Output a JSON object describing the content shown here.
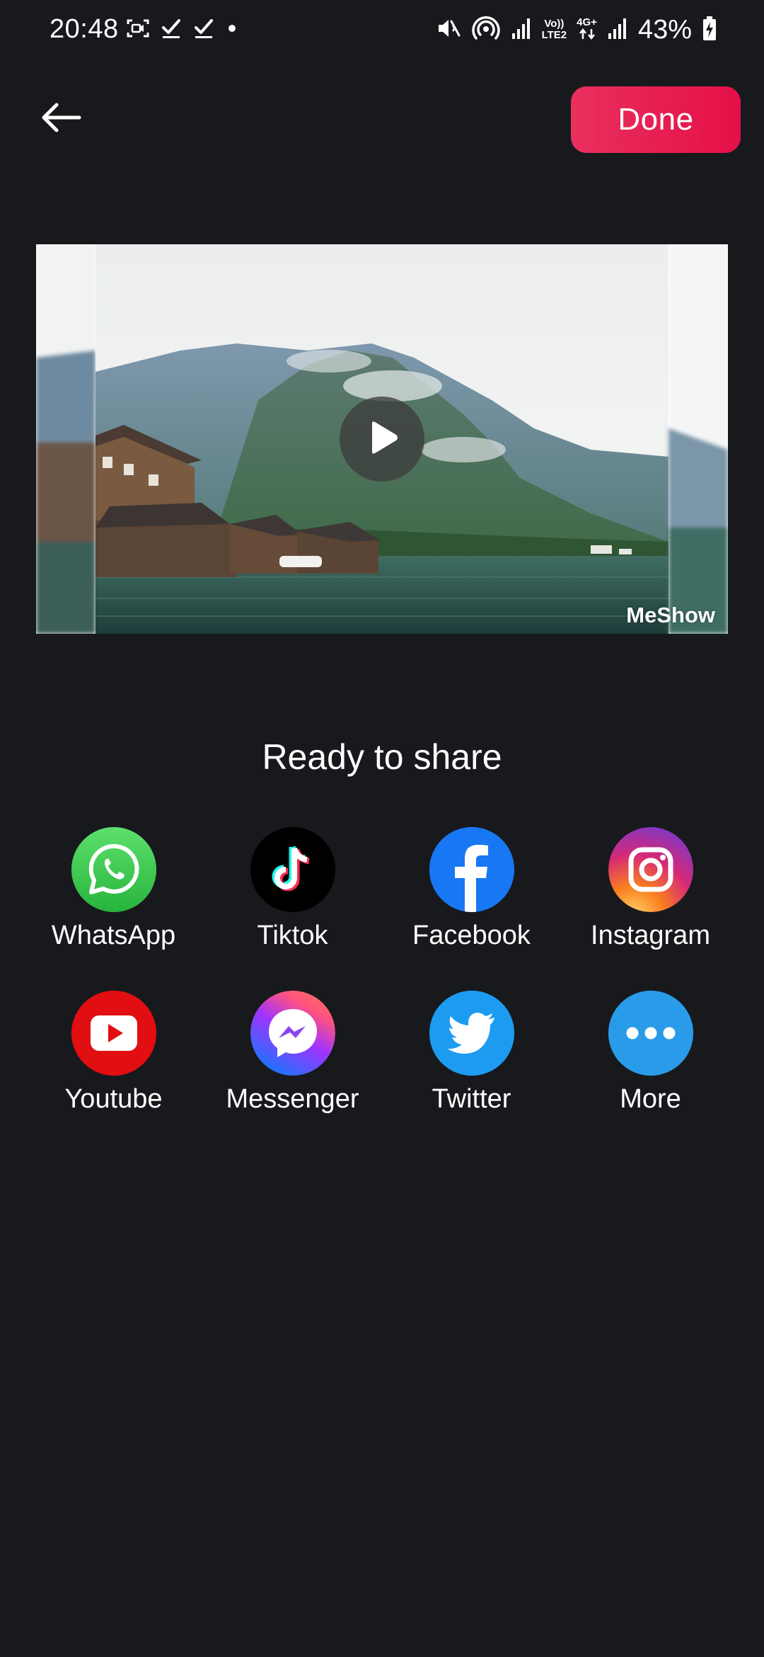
{
  "status_bar": {
    "time": "20:48",
    "battery_percent": "43%",
    "network_label_top": "Vo))",
    "network_label_bottom": "LTE2",
    "network_type": "4G+"
  },
  "header": {
    "done_label": "Done"
  },
  "video": {
    "watermark": "MeShow"
  },
  "share": {
    "title": "Ready to share",
    "items": [
      {
        "label": "WhatsApp",
        "icon": "whatsapp-icon",
        "color": "#35c94a"
      },
      {
        "label": "Tiktok",
        "icon": "tiktok-icon",
        "color": "#000000"
      },
      {
        "label": "Facebook",
        "icon": "facebook-icon",
        "color": "#1877f2"
      },
      {
        "label": "Instagram",
        "icon": "instagram-icon",
        "color": "#d6249f"
      },
      {
        "label": "Youtube",
        "icon": "youtube-icon",
        "color": "#e10e12"
      },
      {
        "label": "Messenger",
        "icon": "messenger-icon",
        "color": "#a033ff"
      },
      {
        "label": "Twitter",
        "icon": "twitter-icon",
        "color": "#1d9bf0"
      },
      {
        "label": "More",
        "icon": "more-icon",
        "color": "#2a9be8"
      }
    ]
  },
  "colors": {
    "background": "#18191d",
    "accent": "#e50f47"
  }
}
